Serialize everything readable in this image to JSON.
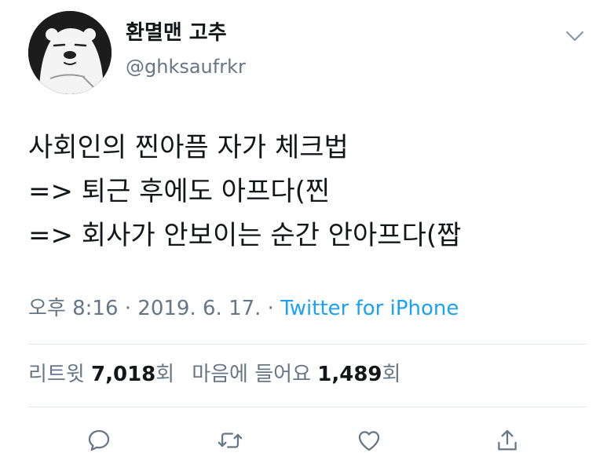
{
  "user": {
    "display_name": "환멸맨 고추",
    "handle": "@ghksaufrkr",
    "avatar_icon": "polar-bear-avatar-icon"
  },
  "tweet": {
    "lines": [
      "사회인의 찐아픔 자가 체크법",
      "=> 퇴근 후에도 아프다(찐",
      "=> 회사가 안보이는 순간 안아프다(짭"
    ],
    "time": "오후 8:16",
    "separator": " · ",
    "date": "2019. 6. 17.",
    "source": "Twitter for iPhone"
  },
  "stats": {
    "retweets_label": "리트윗",
    "retweets_count": "7,018",
    "retweets_suffix": "회",
    "likes_label": "마음에 들어요",
    "likes_count": "1,489",
    "likes_suffix": "회"
  },
  "actions": [
    "reply-icon",
    "retweet-icon",
    "like-icon",
    "share-icon"
  ],
  "colors": {
    "text": "#14171a",
    "secondary": "#657786",
    "link": "#1da1f2",
    "divider": "#e1e8ed"
  }
}
